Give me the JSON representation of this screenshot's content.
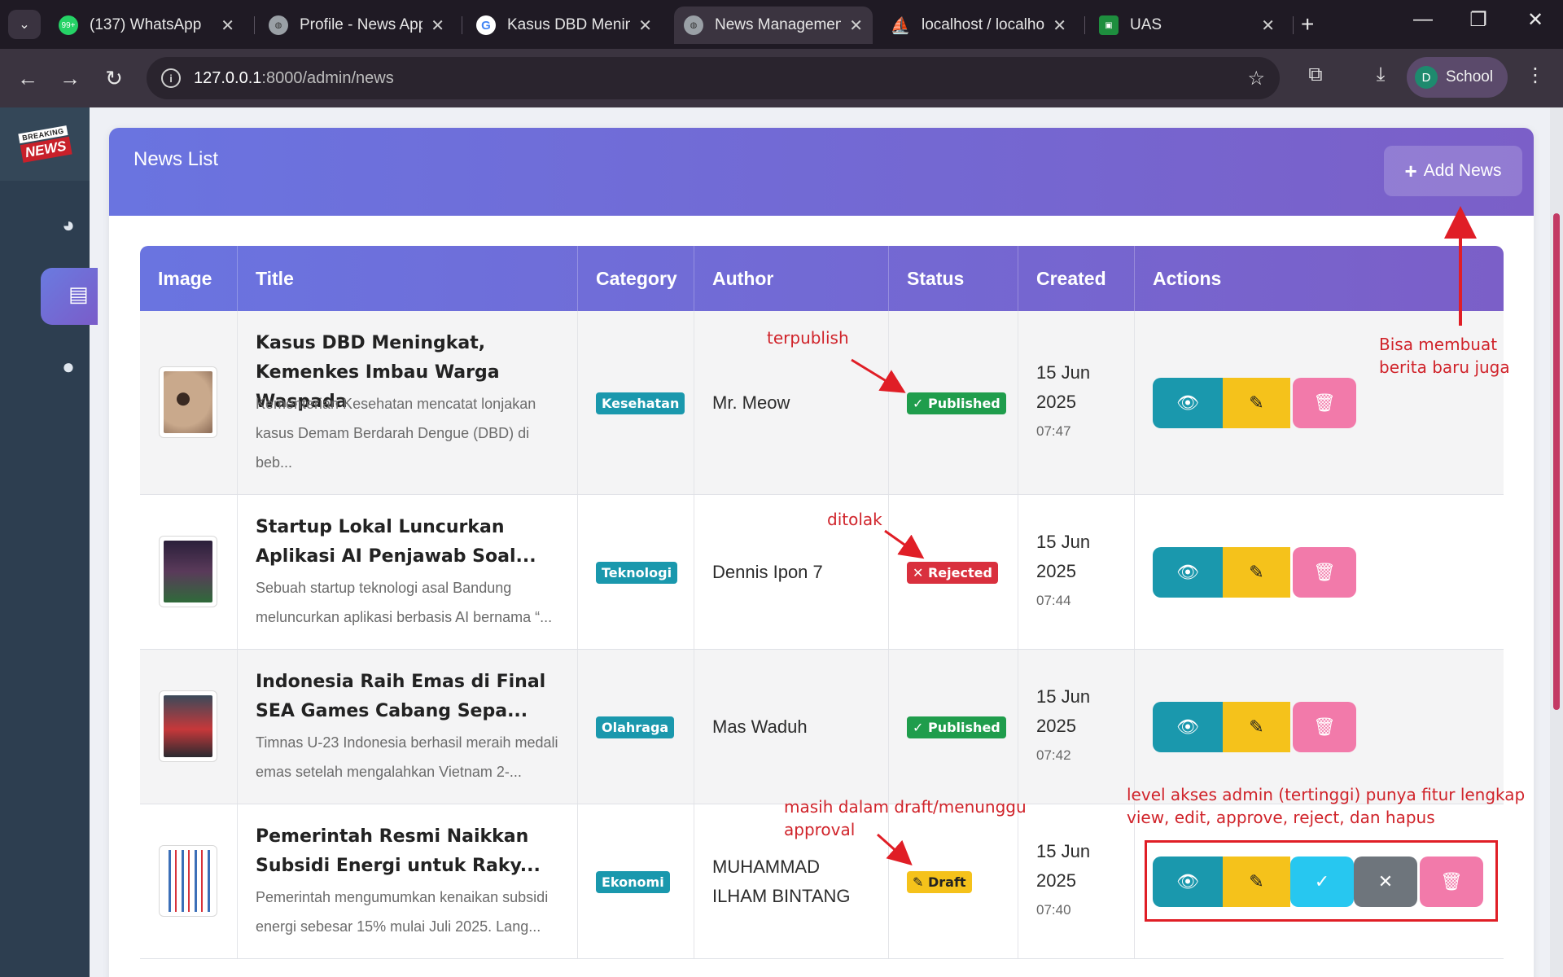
{
  "browser": {
    "tabs": [
      {
        "title": "(137) WhatsApp",
        "favicon": "whatsapp-icon",
        "badge": "99+"
      },
      {
        "title": "Profile - News App",
        "favicon": "globe-icon"
      },
      {
        "title": "Kasus DBD Meningkat",
        "favicon": "google-icon"
      },
      {
        "title": "News Management",
        "favicon": "globe-icon",
        "active": true
      },
      {
        "title": "localhost / localhost",
        "favicon": "phpmyadmin-icon"
      },
      {
        "title": "UAS",
        "favicon": "classroom-icon"
      }
    ],
    "url_host": "127.0.0.1",
    "url_path": ":8000/admin/news",
    "profile": {
      "initial": "D",
      "name": "School"
    }
  },
  "sidebar": {
    "logo_top": "BREAKING",
    "logo_bottom": "NEWS",
    "items": [
      {
        "icon": "dashboard-gauge-icon"
      },
      {
        "icon": "newspaper-icon",
        "active": true
      },
      {
        "icon": "user-icon"
      }
    ]
  },
  "card": {
    "title": "News List",
    "add_button": "Add News"
  },
  "table": {
    "headers": [
      "Image",
      "Title",
      "Category",
      "Author",
      "Status",
      "Created",
      "Actions"
    ],
    "rows": [
      {
        "title": "Kasus DBD Meningkat, Kemenkes Imbau Warga Waspada",
        "excerpt": "Kementerian Kesehatan mencatat lonjakan kasus Demam Berdarah Dengue (DBD) di beb...",
        "category": "Kesehatan",
        "author": "Mr. Meow",
        "status": "Published",
        "status_icon": "✓",
        "date": "15 Jun 2025",
        "time": "07:47"
      },
      {
        "title": "Startup Lokal Luncurkan Aplikasi AI Penjawab Soal...",
        "excerpt": "Sebuah startup teknologi asal Bandung meluncurkan aplikasi berbasis AI bernama “...",
        "category": "Teknologi",
        "author": "Dennis Ipon 7",
        "status": "Rejected",
        "status_icon": "✕",
        "date": "15 Jun 2025",
        "time": "07:44"
      },
      {
        "title": "Indonesia Raih Emas di Final SEA Games Cabang Sepa...",
        "excerpt": "Timnas U-23 Indonesia berhasil meraih medali emas setelah mengalahkan Vietnam 2-...",
        "category": "Olahraga",
        "author": "Mas Waduh",
        "status": "Published",
        "status_icon": "✓",
        "date": "15 Jun 2025",
        "time": "07:42"
      },
      {
        "title": "Pemerintah Resmi Naikkan Subsidi Energi untuk Raky...",
        "excerpt": "Pemerintah mengumumkan kenaikan subsidi energi sebesar 15% mulai Juli 2025. Lang...",
        "category": "Ekonomi",
        "author": "MUHAMMAD ILHAM BINTANG",
        "status": "Draft",
        "status_icon": "✎",
        "date": "15 Jun 2025",
        "time": "07:40"
      }
    ]
  },
  "annotations": {
    "published": "terpublish",
    "rejected": "ditolak",
    "draft": "masih dalam draft/menunggu approval",
    "add": "Bisa membuat berita baru juga",
    "admin": "level akses admin (tertinggi) punya fitur lengkap view, edit, approve, reject, dan hapus"
  },
  "colors": {
    "header_gradient_start": "#6a74e0",
    "header_gradient_end": "#7b5fc8",
    "published": "#1f9d4c",
    "rejected": "#d9303e",
    "draft": "#f5c21b",
    "category": "#1a98ad",
    "annotation": "#d0232a"
  }
}
